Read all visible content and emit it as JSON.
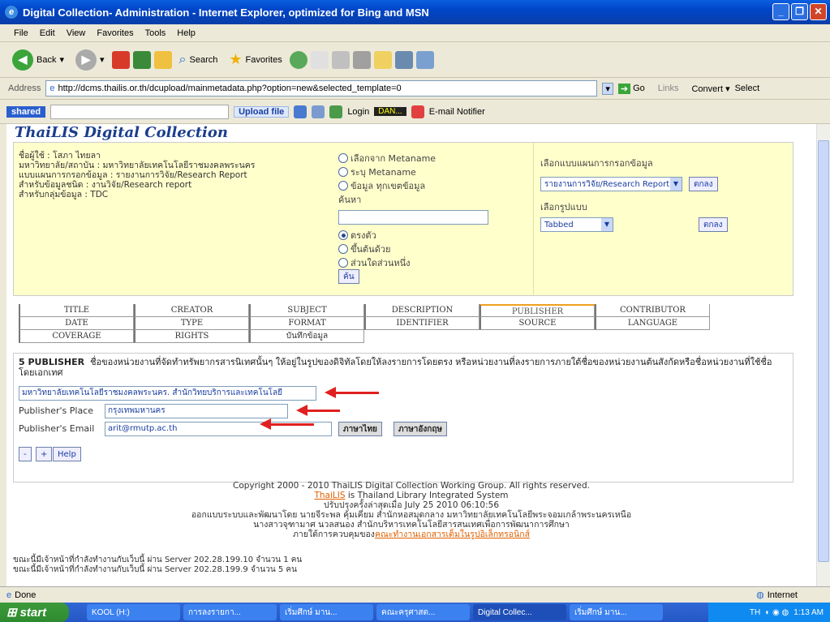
{
  "window": {
    "title": "Digital Collection- Administration - Internet Explorer, optimized for Bing and MSN"
  },
  "menu": [
    "File",
    "Edit",
    "View",
    "Favorites",
    "Tools",
    "Help"
  ],
  "toolbar": {
    "back": "Back",
    "search": "Search",
    "favorites": "Favorites"
  },
  "address": {
    "label": "Address",
    "url": "http://dcms.thailis.or.th/dcupload/mainmetadata.php?option=new&selected_template=0",
    "go": "Go",
    "links": "Links",
    "convert": "Convert",
    "select": "Select"
  },
  "linkbar": {
    "shared": "shared",
    "upload": "Upload file",
    "login": "Login",
    "dan": "DAN...",
    "email": "E-mail Notifier"
  },
  "page": {
    "logo": "ThaiLIS Digital Collection",
    "info": [
      "ชื่อผู้ใช้ : โสภา ไทยลา",
      "มหาวิทยาลัย/สถาบัน : มหาวิทยาลัยเทคโนโลยีราชมงคลพระนคร",
      "แบบแผนการกรอกข้อมูล : รายงานการวิจัย/Research Report",
      "สำหรับข้อมูลชนิด : งานวิจัย/Research report",
      "สำหรับกลุ่มข้อมูล : TDC"
    ],
    "meta_opts": [
      "เลือกจาก Metaname",
      "ระบุ Metaname",
      "ข้อมูล ทุกเขตข้อมูล"
    ],
    "search_label": "ค้นหา",
    "match_opts": [
      "ตรงตัว",
      "ขึ้นต้นด้วย",
      "ส่วนใดส่วนหนึ่ง"
    ],
    "search_btn": "ค้น",
    "template_label": "เลือกแบบแผนการกรอกข้อมูล",
    "template_value": "รายงานการวิจัย/Research Report",
    "ok1": "ตกลง",
    "format_label": "เลือกรูปแบบ",
    "format_value": "Tabbed",
    "ok2": "ตกลง",
    "tabs_row1": [
      "TITLE",
      "CREATOR",
      "SUBJECT",
      "DESCRIPTION",
      "PUBLISHER",
      "CONTRIBUTOR"
    ],
    "tabs_row2": [
      "DATE",
      "TYPE",
      "FORMAT",
      "IDENTIFIER",
      "SOURCE",
      "LANGUAGE"
    ],
    "tabs_row3": [
      "COVERAGE",
      "RIGHTS",
      "บันทึกข้อมูล"
    ],
    "pub_heading": "5 PUBLISHER",
    "pub_desc": "ชื่อของหน่วยงานที่จัดทำทรัพยากรสารนิเทศนั้นๆ ให้อยู่ในรูปของดิจิทัลโดยให้ลงรายการโดยตรง หรือหน่วยงานที่ลงรายการภายใต้ชื่อของหน่วยงานต้นสังกัดหรือชื่อหน่วยงานที่ใช้ชื่อโดยเอกเทศ",
    "publisher_value": "มหาวิทยาลัยเทคโนโลยีราชมงคลพระนคร. สำนักวิทยบริการและเทคโนโลยี",
    "place_label": "Publisher's Place",
    "place_value": "กรุงเทพมหานคร",
    "email_label": "Publisher's Email",
    "email_value": "arit@rmutp.ac.th",
    "thai_btn": "ภาษาไทย",
    "eng_btn": "ภาษาอังกฤษ",
    "minus": "-",
    "plus": "+",
    "help": "Help",
    "copyright": "Copyright 2000 - 2010 ThaiLIS Digital Collection Working Group. All rights reserved.",
    "thailis_link": "ThaiLIS",
    "thailis_text": "is Thailand Library Integrated System",
    "updated": "ปรับปรุงครั้งล่าสุดเมื่อ July 25 2010 06:10:56",
    "designed": "ออกแบบระบบและพัฒนาโดย นายจีระพล คุ้มเคี่ยม สำนักหอสมุดกลาง มหาวิทยาลัยเทคโนโลยีพระจอมเกล้าพระนครเหนือ",
    "staff": "นางสาวจุฑามาศ นวลสนอง สำนักบริหารเทคโนโลยีสารสนเทศเพื่อการพัฒนาการศึกษา",
    "control_text": "ภายใต้การควบคุมของ",
    "control_link": "คณะทำงานเอกสารเต็มในรูปอิเล็กทรอนิกส์",
    "online1": "ขณะนี้มีเจ้าหน้าที่กำลังทำงานกับเว็บนี้ ผ่าน Server 202.28.199.10 จำนวน 1 คน",
    "online2": "ขณะนี้มีเจ้าหน้าที่กำลังทำงานกับเว็บนี้ ผ่าน Server 202.28.199.9 จำนวน 5 คน"
  },
  "status": {
    "left": "Done",
    "right": "Internet"
  },
  "taskbar": {
    "start": "start",
    "tasks": [
      "KOOL (H:)",
      "การลงรายกา...",
      "เริ่มศึกษ์ มาน...",
      "คณะครุศาสต...",
      "Digital Collec...",
      "เริ่มศึกษ์ มาน..."
    ],
    "clock": "1:13 AM",
    "lang": "TH"
  }
}
